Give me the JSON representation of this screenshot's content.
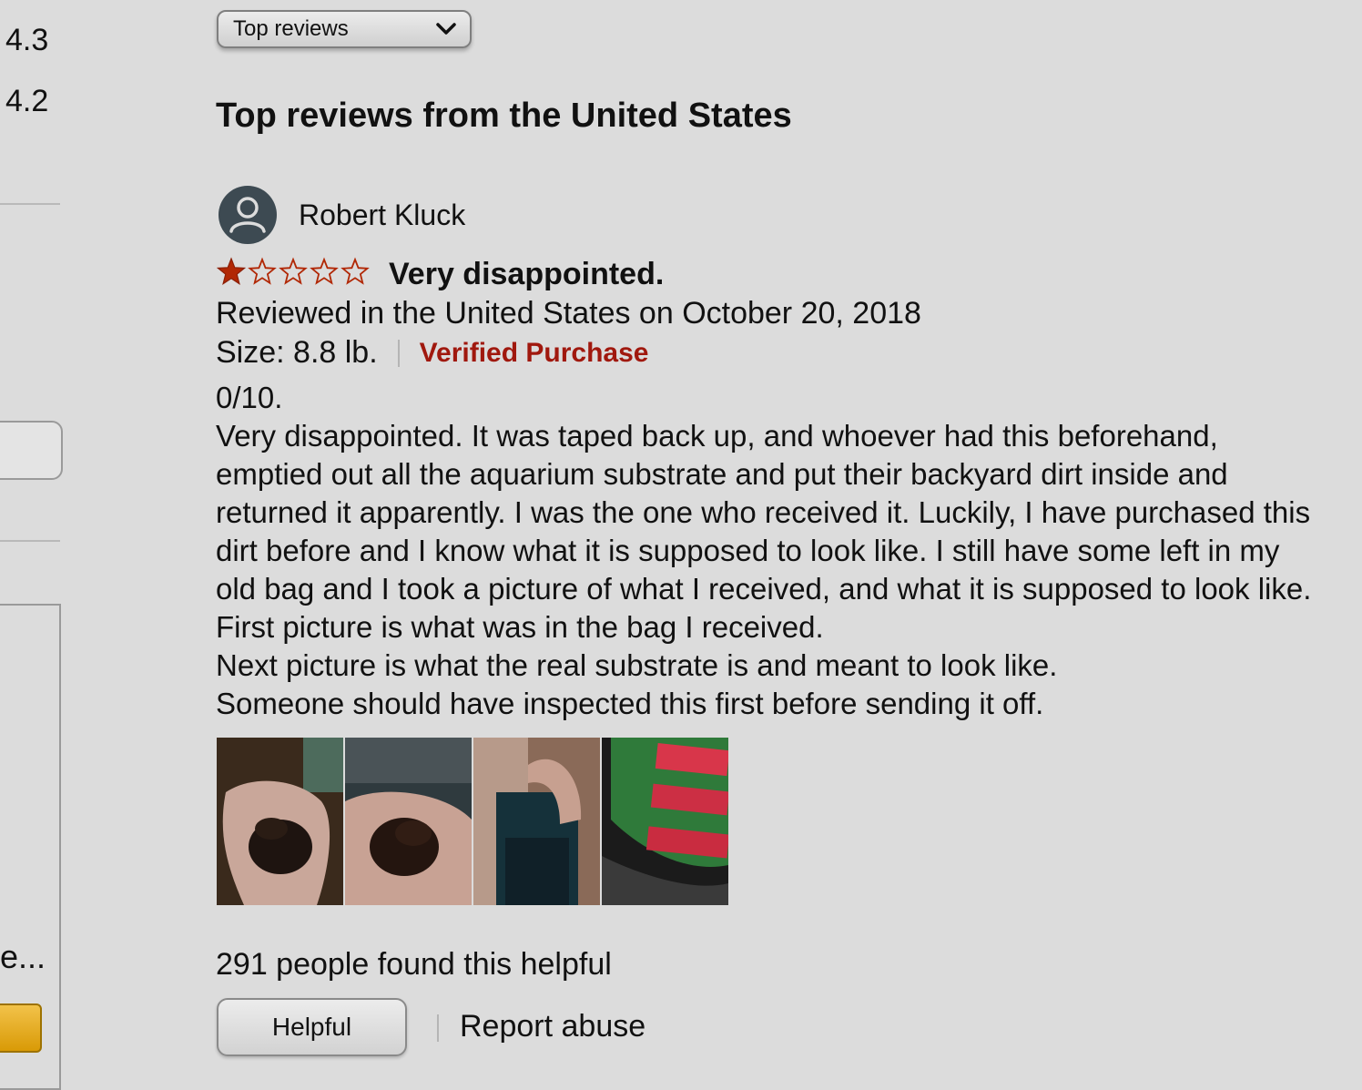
{
  "sidebar": {
    "ratings": [
      "4.3",
      "4.2"
    ],
    "truncated_text": "e..."
  },
  "sort": {
    "selected": "Top reviews"
  },
  "section_title": "Top reviews from the United States",
  "review": {
    "reviewer": "Robert Kluck",
    "rating": 1,
    "rating_max": 5,
    "title": "Very disappointed.",
    "date_line": "Reviewed in the United States on October 20, 2018",
    "size": "Size: 8.8 lb.",
    "verified": "Verified Purchase",
    "body_lines": [
      "0/10.",
      "Very disappointed. It was taped back up, and whoever had this beforehand,",
      "emptied out all the aquarium substrate and put their backyard dirt inside and",
      "returned it apparently. I was the one who received it. Luckily, I have purchased this",
      "dirt before and I know what it is supposed to look like. I still have some left in my",
      "old bag and I took a picture of what I received, and what it is supposed to look like.",
      "First picture is what was in the bag I received.",
      "Next picture is what the real substrate is and meant to look like.",
      "Someone should have inspected this first before sending it off."
    ],
    "photo_count": 4,
    "helpful_count": "291 people found this helpful",
    "helpful_button": "Helpful",
    "report_link": "Report abuse"
  },
  "colors": {
    "background": "#dcdcdc",
    "star": "#b12704",
    "verified": "#a0180e",
    "button_accent": "#e2a60e"
  }
}
